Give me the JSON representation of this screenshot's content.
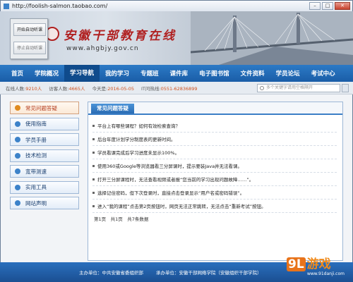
{
  "window": {
    "url": "http://foolish-salmon.taobao.com/"
  },
  "floating_panel": {
    "start_label": "开始自动听课",
    "stop_label": "停止自动听课"
  },
  "header": {
    "site_title": "安徽干部教育在线",
    "site_url": "www.ahgbjy.gov.cn"
  },
  "nav": {
    "items": [
      "首页",
      "学院概况",
      "学习导航",
      "我的学习",
      "专题班",
      "课件库",
      "电子图书馆",
      "文件资料",
      "学员论坛",
      "考试中心"
    ],
    "active_index": 2
  },
  "stats": {
    "online_label": "在线人数:",
    "online_value": "9210人",
    "visits_label": "访客人数:",
    "visits_value": "4665人",
    "date_label": "今天是:",
    "date_value": "2016-05-05",
    "hotline_label": "IT问热线:",
    "hotline_value": "0551-62836899"
  },
  "search": {
    "placeholder": "多个关键字请用空格隔开"
  },
  "sidebar": {
    "items": [
      {
        "label": "常见问题答疑",
        "icon": "question-icon",
        "active": true
      },
      {
        "label": "使用指南",
        "icon": "guide-icon"
      },
      {
        "label": "学员手册",
        "icon": "book-icon"
      },
      {
        "label": "技术检测",
        "icon": "check-icon"
      },
      {
        "label": "宽带测速",
        "icon": "speed-icon"
      },
      {
        "label": "实用工具",
        "icon": "tool-icon"
      },
      {
        "label": "网站声明",
        "icon": "notice-icon"
      }
    ]
  },
  "content": {
    "tab_label": "常见问题答疑",
    "rows": [
      "平台上有哪些课程？如何有效检索查询？",
      "后台年度计划学分制度表的更新时间。",
      "学员看课完成后学习进度未显示100%。",
      "使用360或Google等浏览器看三分屏课时，提示要装Java并无法看课。",
      "打开三分屏课程时，无法查看视频或者报“您当前的学习出现问题故障……”。",
      "选择记住密码，但下次登录时，直接点击登录显示“用户名或密码错误”。",
      "进入“我的课程”点击第2页按钮时，网页无法正常跳转，无法点击“重新考试”按钮。"
    ],
    "pager": "第1页　共1页　共7条数据"
  },
  "footer": {
    "host": "主办单位：中共安徽省委组织部",
    "organizer": "承办单位：安徽干部网络学院（安徽组织干部学院）"
  },
  "watermark": {
    "logo_num": "9L",
    "logo_text": "游戏",
    "url": "www.91danji.com"
  },
  "colors": {
    "nav_blue": "#1a5da7",
    "title_red": "#b02020",
    "accent_orange": "#e08a1f"
  }
}
